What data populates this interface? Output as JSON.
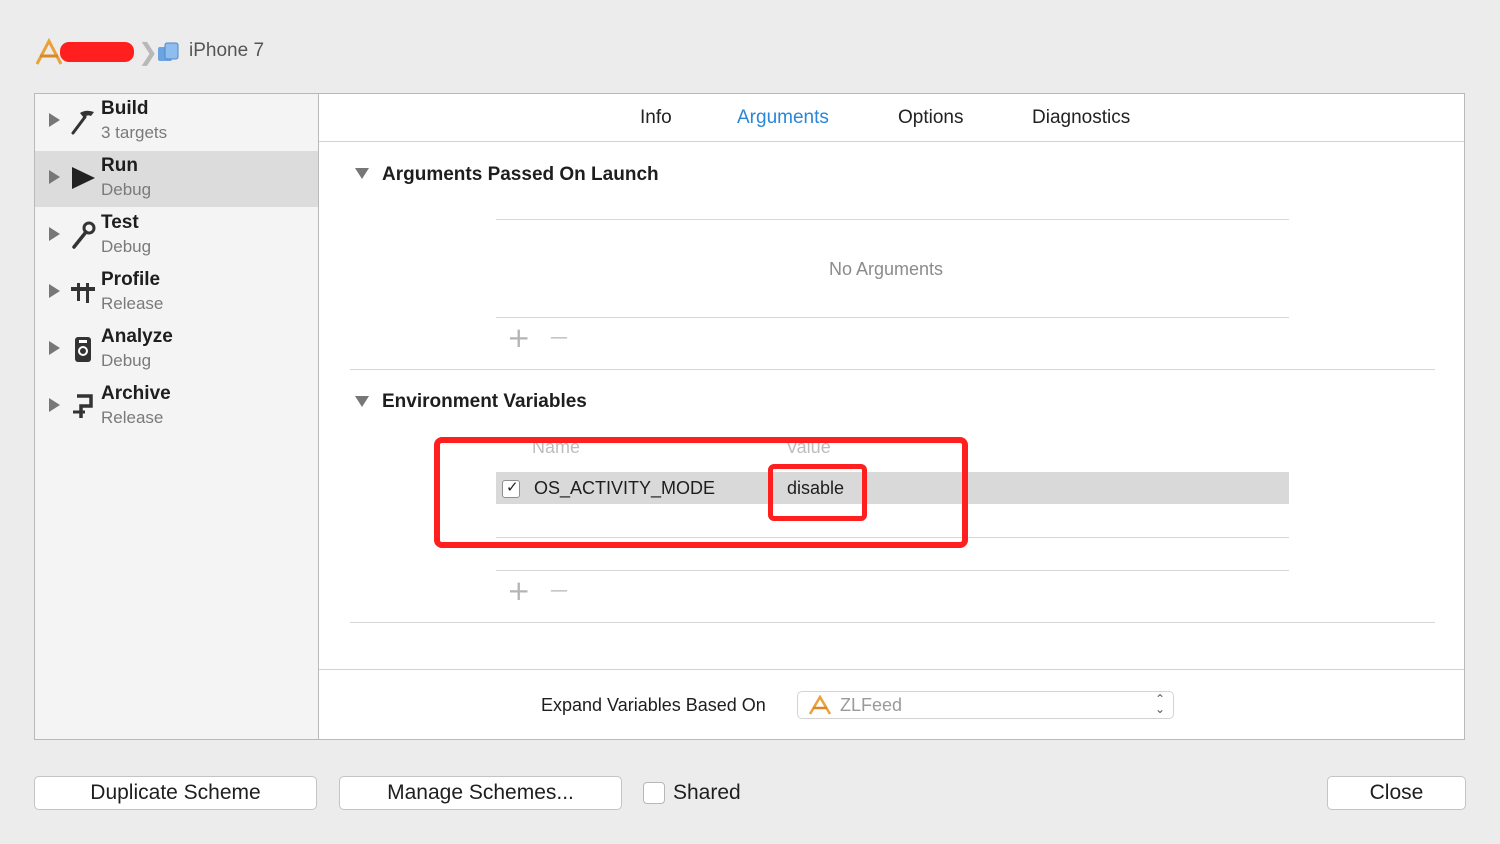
{
  "breadcrumb": {
    "device": "iPhone 7",
    "separator": "❯"
  },
  "sidebar": {
    "items": [
      {
        "title": "Build",
        "subtitle": "3 targets",
        "icon": "hammer-icon"
      },
      {
        "title": "Run",
        "subtitle": "Debug",
        "icon": "play-icon",
        "selected": true
      },
      {
        "title": "Test",
        "subtitle": "Debug",
        "icon": "wrench-icon"
      },
      {
        "title": "Profile",
        "subtitle": "Release",
        "icon": "caliper-icon"
      },
      {
        "title": "Analyze",
        "subtitle": "Debug",
        "icon": "analyze-icon"
      },
      {
        "title": "Archive",
        "subtitle": "Release",
        "icon": "archive-icon"
      }
    ]
  },
  "tabs": [
    {
      "label": "Info"
    },
    {
      "label": "Arguments",
      "active": true
    },
    {
      "label": "Options"
    },
    {
      "label": "Diagnostics"
    }
  ],
  "arguments": {
    "title": "Arguments Passed On Launch",
    "empty_text": "No Arguments",
    "add": "+",
    "remove": "—"
  },
  "environment": {
    "title": "Environment Variables",
    "col_name": "Name",
    "col_value": "Value",
    "rows": [
      {
        "enabled": true,
        "name": "OS_ACTIVITY_MODE",
        "value": "disable"
      }
    ],
    "check": "✓",
    "add": "+",
    "remove": "—"
  },
  "expand": {
    "label": "Expand Variables Based On",
    "selected": "ZLFeed",
    "arrows_up": "⌃",
    "arrows_down": "⌄"
  },
  "footer": {
    "duplicate": "Duplicate Scheme",
    "manage": "Manage Schemes...",
    "shared": "Shared",
    "close": "Close"
  },
  "colors": {
    "accent": "#2a86d6",
    "highlight": "#ff1f1f"
  }
}
